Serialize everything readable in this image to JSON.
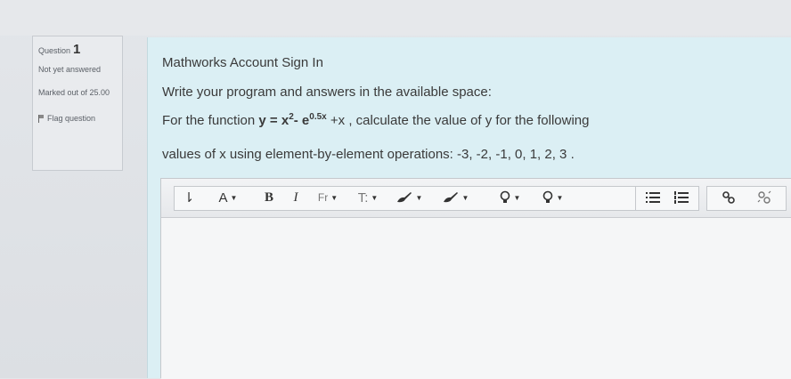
{
  "question_info": {
    "label": "Question",
    "number": "1",
    "state": "Not yet answered",
    "grade": "Marked out of 25.00",
    "flag_label": "Flag question"
  },
  "question": {
    "line1": "Mathworks Account Sign In",
    "line2": "Write your program and answers in the available space:",
    "line3_prefix": "For the function ",
    "line3_func_y": "y = x",
    "line3_sup1": "2",
    "line3_func_e": "- e",
    "line3_sup2": "0.5x",
    "line3_suffix": " +x , calculate the value of y for the following",
    "line4": "values of x using element-by-element operations: -3, -2, -1, 0, 1, 2, 3 ."
  },
  "editor": {
    "toolbar": {
      "expand": "⇂",
      "font_color": "A",
      "bold": "B",
      "italic": "I",
      "font_family": "Fr",
      "font_size": "T:",
      "caret": "▼"
    },
    "content": ""
  }
}
